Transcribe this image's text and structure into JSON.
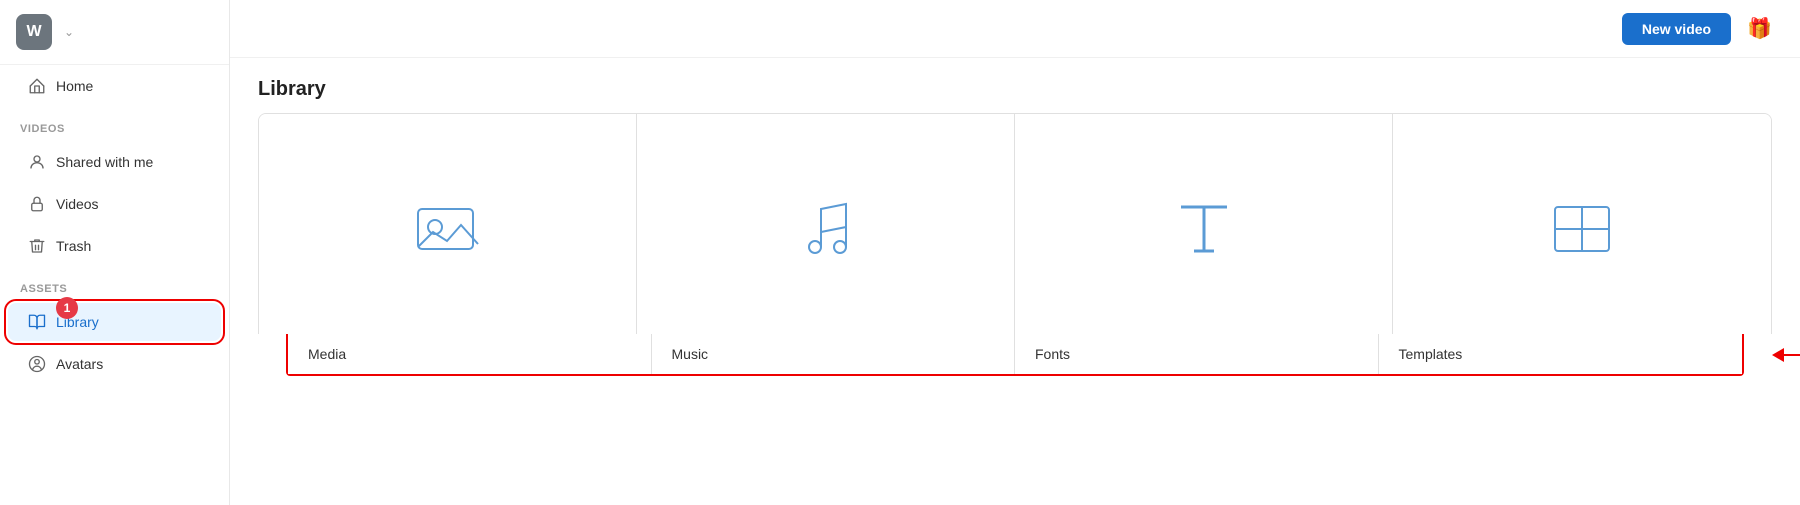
{
  "sidebar": {
    "logo": "W",
    "sections": [
      {
        "label": "",
        "items": [
          {
            "id": "home",
            "label": "Home",
            "icon": "home",
            "active": false
          }
        ]
      },
      {
        "label": "Videos",
        "items": [
          {
            "id": "shared",
            "label": "Shared with me",
            "icon": "person",
            "active": false
          },
          {
            "id": "videos",
            "label": "Videos",
            "icon": "lock",
            "active": false
          },
          {
            "id": "trash",
            "label": "Trash",
            "icon": "trash",
            "active": false
          }
        ]
      },
      {
        "label": "Assets",
        "items": [
          {
            "id": "library",
            "label": "Library",
            "icon": "book",
            "active": true,
            "badge": "1"
          },
          {
            "id": "avatars",
            "label": "Avatars",
            "icon": "user-circle",
            "active": false
          }
        ]
      }
    ]
  },
  "topbar": {
    "new_video_label": "New video"
  },
  "main": {
    "title": "Library",
    "cards": [
      {
        "id": "media",
        "label": "Media"
      },
      {
        "id": "music",
        "label": "Music"
      },
      {
        "id": "fonts",
        "label": "Fonts"
      },
      {
        "id": "templates",
        "label": "Templates"
      }
    ]
  }
}
